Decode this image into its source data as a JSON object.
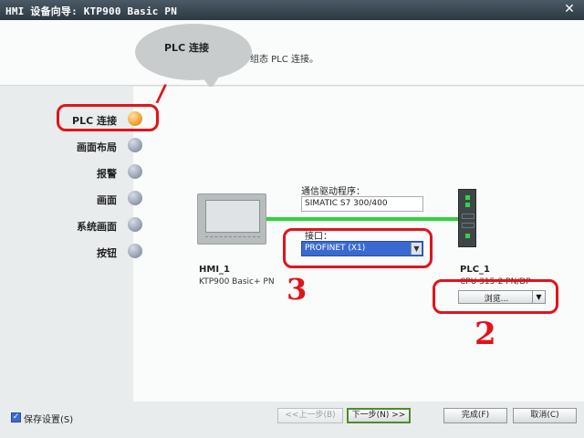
{
  "window": {
    "title": "HMI 设备向导: KTP900 Basic PN",
    "close_glyph": "✕"
  },
  "banner": {
    "bubble_title": "PLC 连接",
    "description": "组态 PLC 连接。"
  },
  "sidebar": {
    "items": [
      {
        "label": "PLC 连接",
        "active": true
      },
      {
        "label": "画面布局",
        "active": false
      },
      {
        "label": "报警",
        "active": false
      },
      {
        "label": "画面",
        "active": false
      },
      {
        "label": "系统画面",
        "active": false
      },
      {
        "label": "按钮",
        "active": false
      }
    ]
  },
  "config": {
    "driver_label": "通信驱动程序：",
    "driver_value": "SIMATIC S7 300/400",
    "interface_label": "接口：",
    "interface_value": "PROFINET (X1)",
    "dropdown_glyph": "▼"
  },
  "devices": {
    "hmi": {
      "name": "HMI_1",
      "type": "KTP900 Basic+ PN"
    },
    "plc": {
      "name": "PLC_1",
      "type": "CPU 315-2 PN/DP"
    },
    "browse_label": "浏览...",
    "browse_glyph": "▼"
  },
  "annotations": {
    "mark_1": "/",
    "mark_2": "2",
    "mark_3": "3"
  },
  "footer": {
    "save_settings_label": "保存设置(S)",
    "save_settings_checked": true,
    "check_glyph": "✓",
    "prev_label": "<<上一步(B)",
    "next_label": "下一步(N) >>",
    "finish_label": "完成(F)",
    "cancel_label": "取消(C)"
  },
  "colors": {
    "active_step": "#f2a237",
    "link": "#2fd33a",
    "annotation": "#e1141a",
    "selection": "#3a6ad0"
  },
  "icons": {
    "step_dot": "step-dot-icon",
    "hmi_device": "hmi-panel-icon",
    "plc_device": "plc-cpu-icon"
  }
}
